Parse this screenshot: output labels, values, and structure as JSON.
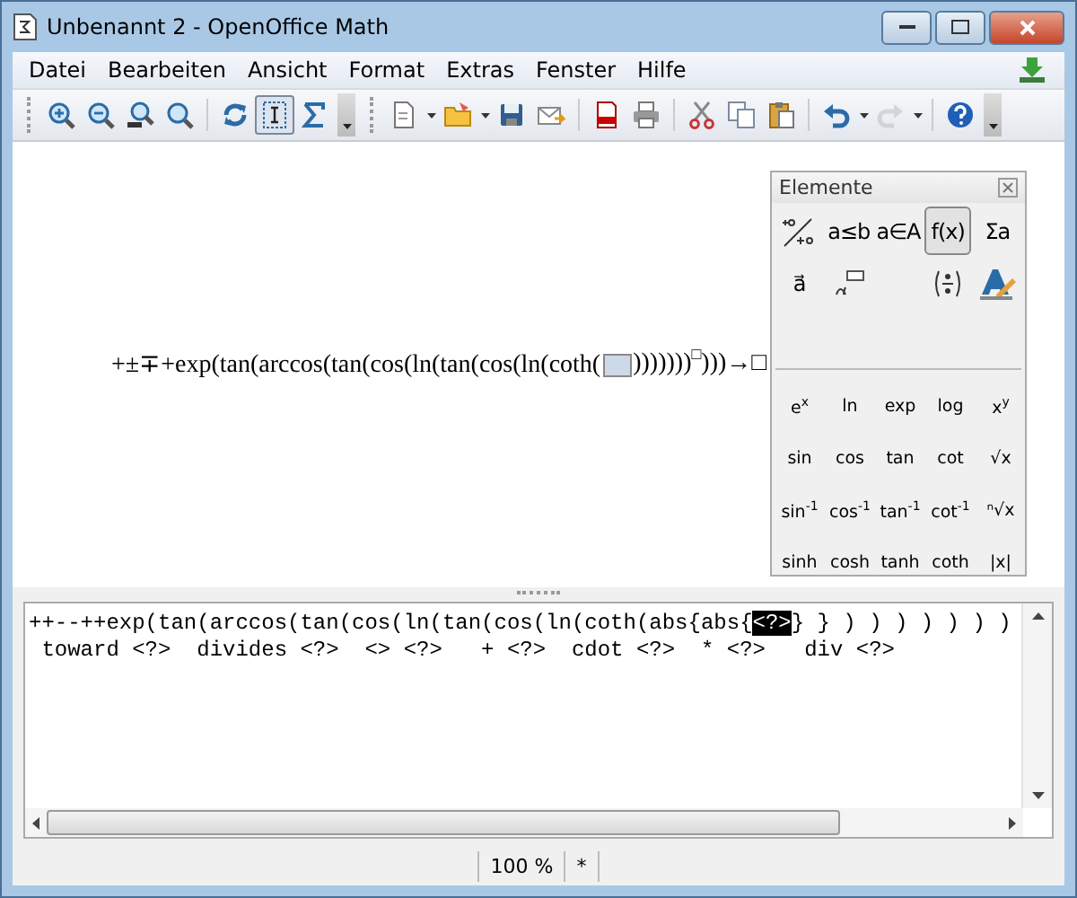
{
  "window": {
    "title": "Unbenannt 2 - OpenOffice Math"
  },
  "menu": [
    {
      "label": "Datei"
    },
    {
      "label": "Bearbeiten"
    },
    {
      "label": "Ansicht"
    },
    {
      "label": "Format"
    },
    {
      "label": "Extras"
    },
    {
      "label": "Fenster"
    },
    {
      "label": "Hilfe"
    }
  ],
  "toolbars": [
    {
      "groups": [
        [
          {
            "kind": "zoom-in",
            "selected": false
          },
          {
            "kind": "zoom-out",
            "selected": false
          },
          {
            "kind": "zoom-100",
            "selected": false
          },
          {
            "kind": "zoom-fit",
            "selected": false
          }
        ],
        [
          {
            "kind": "refresh",
            "selected": false
          },
          {
            "kind": "cursor",
            "selected": true
          },
          {
            "kind": "sum",
            "selected": false
          }
        ]
      ]
    },
    {
      "groups": [
        [
          {
            "kind": "new",
            "selected": false,
            "dropdown": true
          },
          {
            "kind": "open",
            "selected": false,
            "dropdown": true
          },
          {
            "kind": "save",
            "selected": false
          },
          {
            "kind": "mail",
            "selected": false
          }
        ],
        [
          {
            "kind": "pdf",
            "selected": false
          },
          {
            "kind": "print",
            "selected": false
          }
        ],
        [
          {
            "kind": "cut",
            "selected": false
          },
          {
            "kind": "copy",
            "selected": false
          },
          {
            "kind": "paste",
            "selected": false
          }
        ],
        [
          {
            "kind": "undo",
            "selected": false,
            "dropdown": true
          },
          {
            "kind": "redo",
            "selected": false,
            "dropdown": true,
            "disabled": true
          }
        ],
        [
          {
            "kind": "help",
            "selected": false
          }
        ]
      ]
    }
  ],
  "formula": {
    "main": "+±∓+exp(tan(arccos(tan(cos(ln(tan(cos(ln(coth(",
    "close": ")))))))",
    "exponent": "□",
    "tail": ")))→□"
  },
  "elements": {
    "title": "Elemente",
    "categories": [
      {
        "kind": "unary",
        "selected": false
      },
      {
        "kind": "text",
        "label": "a≤b",
        "selected": false
      },
      {
        "kind": "text",
        "label": "a∈A",
        "selected": false
      },
      {
        "kind": "text",
        "label": "f(x)",
        "selected": true
      },
      {
        "kind": "text",
        "label": "Σa",
        "selected": false
      }
    ],
    "categories_row2": [
      {
        "kind": "text",
        "label": "a⃗",
        "selected": false
      },
      {
        "kind": "others",
        "selected": false
      },
      {
        "kind": "brackets",
        "selected": false
      },
      {
        "kind": "format",
        "selected": false
      }
    ],
    "functions": [
      "e$^{x}$",
      "ln",
      "exp",
      "log",
      "x$^{y}$",
      "sin",
      "cos",
      "tan",
      "cot",
      "√x",
      "sin$^{-1}$",
      "cos$^{-1}$",
      "tan$^{-1}$",
      "cot$^{-1}$",
      "ⁿ√x",
      "sinh",
      "cosh",
      "tanh",
      "coth",
      "|x|"
    ]
  },
  "editor": {
    "lines": [
      {
        "before": "++--++exp(tan(arccos(tan(cos(ln(tan(cos(ln(coth(abs{abs{",
        "selection": "<?>",
        "after": "} } ) ) ) ) ) ) )"
      },
      {
        "before": " toward <?>  divides <?>  <> <?>   + <?>  cdot <?>  * <?>   div <?>"
      }
    ]
  },
  "status_bar": {
    "zoom": "100 %",
    "modified": "*"
  }
}
